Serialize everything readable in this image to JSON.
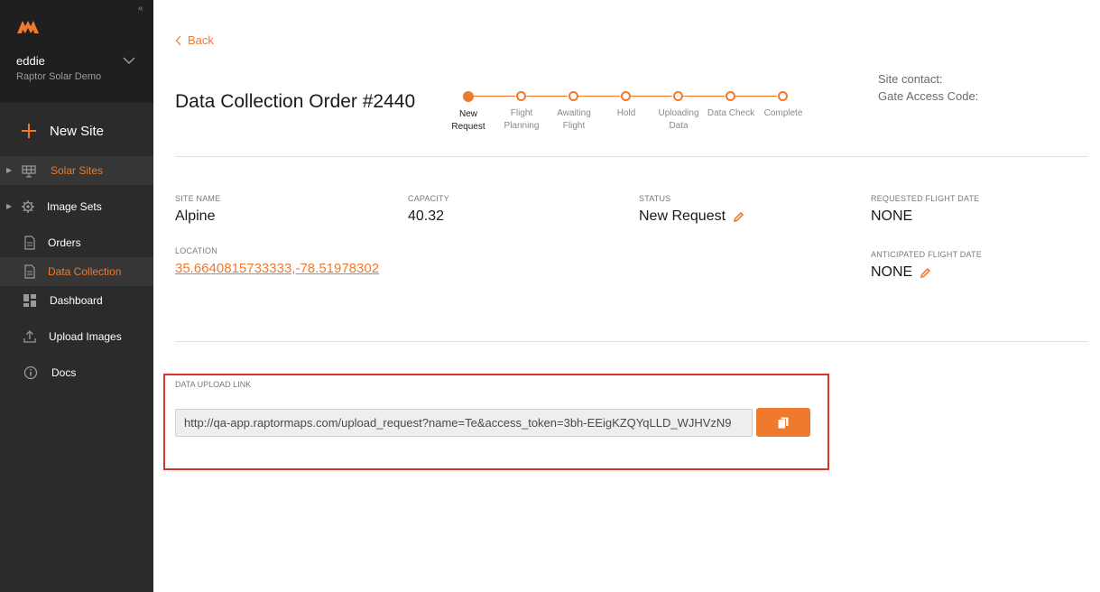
{
  "colors": {
    "accent": "#ef7a2e",
    "sidebar_bg": "#2b2b2b",
    "highlight_border": "#d9342b"
  },
  "sidebar": {
    "user": {
      "name": "eddie",
      "org": "Raptor Solar Demo"
    },
    "new_site_label": "New Site",
    "items": [
      {
        "label": "Solar Sites",
        "icon": "solar-panel-icon",
        "expandable": true,
        "active": true
      },
      {
        "label": "Image Sets",
        "icon": "gear-icon",
        "expandable": true,
        "active": false
      },
      {
        "label": "Orders",
        "icon": "document-icon",
        "expandable": false,
        "active": false
      },
      {
        "label": "Data Collection",
        "icon": "document-icon",
        "expandable": false,
        "active": true
      },
      {
        "label": "Dashboard",
        "icon": "dashboard-icon",
        "expandable": false,
        "active": false
      },
      {
        "label": "Upload Images",
        "icon": "upload-icon",
        "expandable": false,
        "active": false
      },
      {
        "label": "Docs",
        "icon": "info-icon",
        "expandable": false,
        "active": false
      }
    ]
  },
  "header": {
    "back_label": "Back",
    "title": "Data Collection Order #2440",
    "site_contact": "Site contact:",
    "gate_access_code": "Gate Access Code:"
  },
  "stepper": {
    "current_index": 0,
    "steps": [
      {
        "line1": "New",
        "line2": "Request"
      },
      {
        "line1": "Flight",
        "line2": "Planning"
      },
      {
        "line1": "Awaiting",
        "line2": "Flight"
      },
      {
        "line1": "Hold",
        "line2": ""
      },
      {
        "line1": "Uploading",
        "line2": "Data"
      },
      {
        "line1": "Data Check",
        "line2": ""
      },
      {
        "line1": "Complete",
        "line2": ""
      }
    ]
  },
  "details": {
    "site_name_label": "SITE NAME",
    "site_name": "Alpine",
    "capacity_label": "CAPACITY",
    "capacity": "40.32",
    "status_label": "STATUS",
    "status": "New Request",
    "requested_flight_date_label": "REQUESTED FLIGHT DATE",
    "requested_flight_date": "NONE",
    "location_label": "LOCATION",
    "location": "35.6640815733333,-78.51978302",
    "anticipated_flight_date_label": "ANTICIPATED FLIGHT DATE",
    "anticipated_flight_date": "NONE"
  },
  "upload": {
    "label": "DATA UPLOAD LINK",
    "url": "http://qa-app.raptormaps.com/upload_request?name=Te&access_token=3bh-EEigKZQYqLLD_WJHVzN9",
    "copy_icon": "copy-icon"
  }
}
